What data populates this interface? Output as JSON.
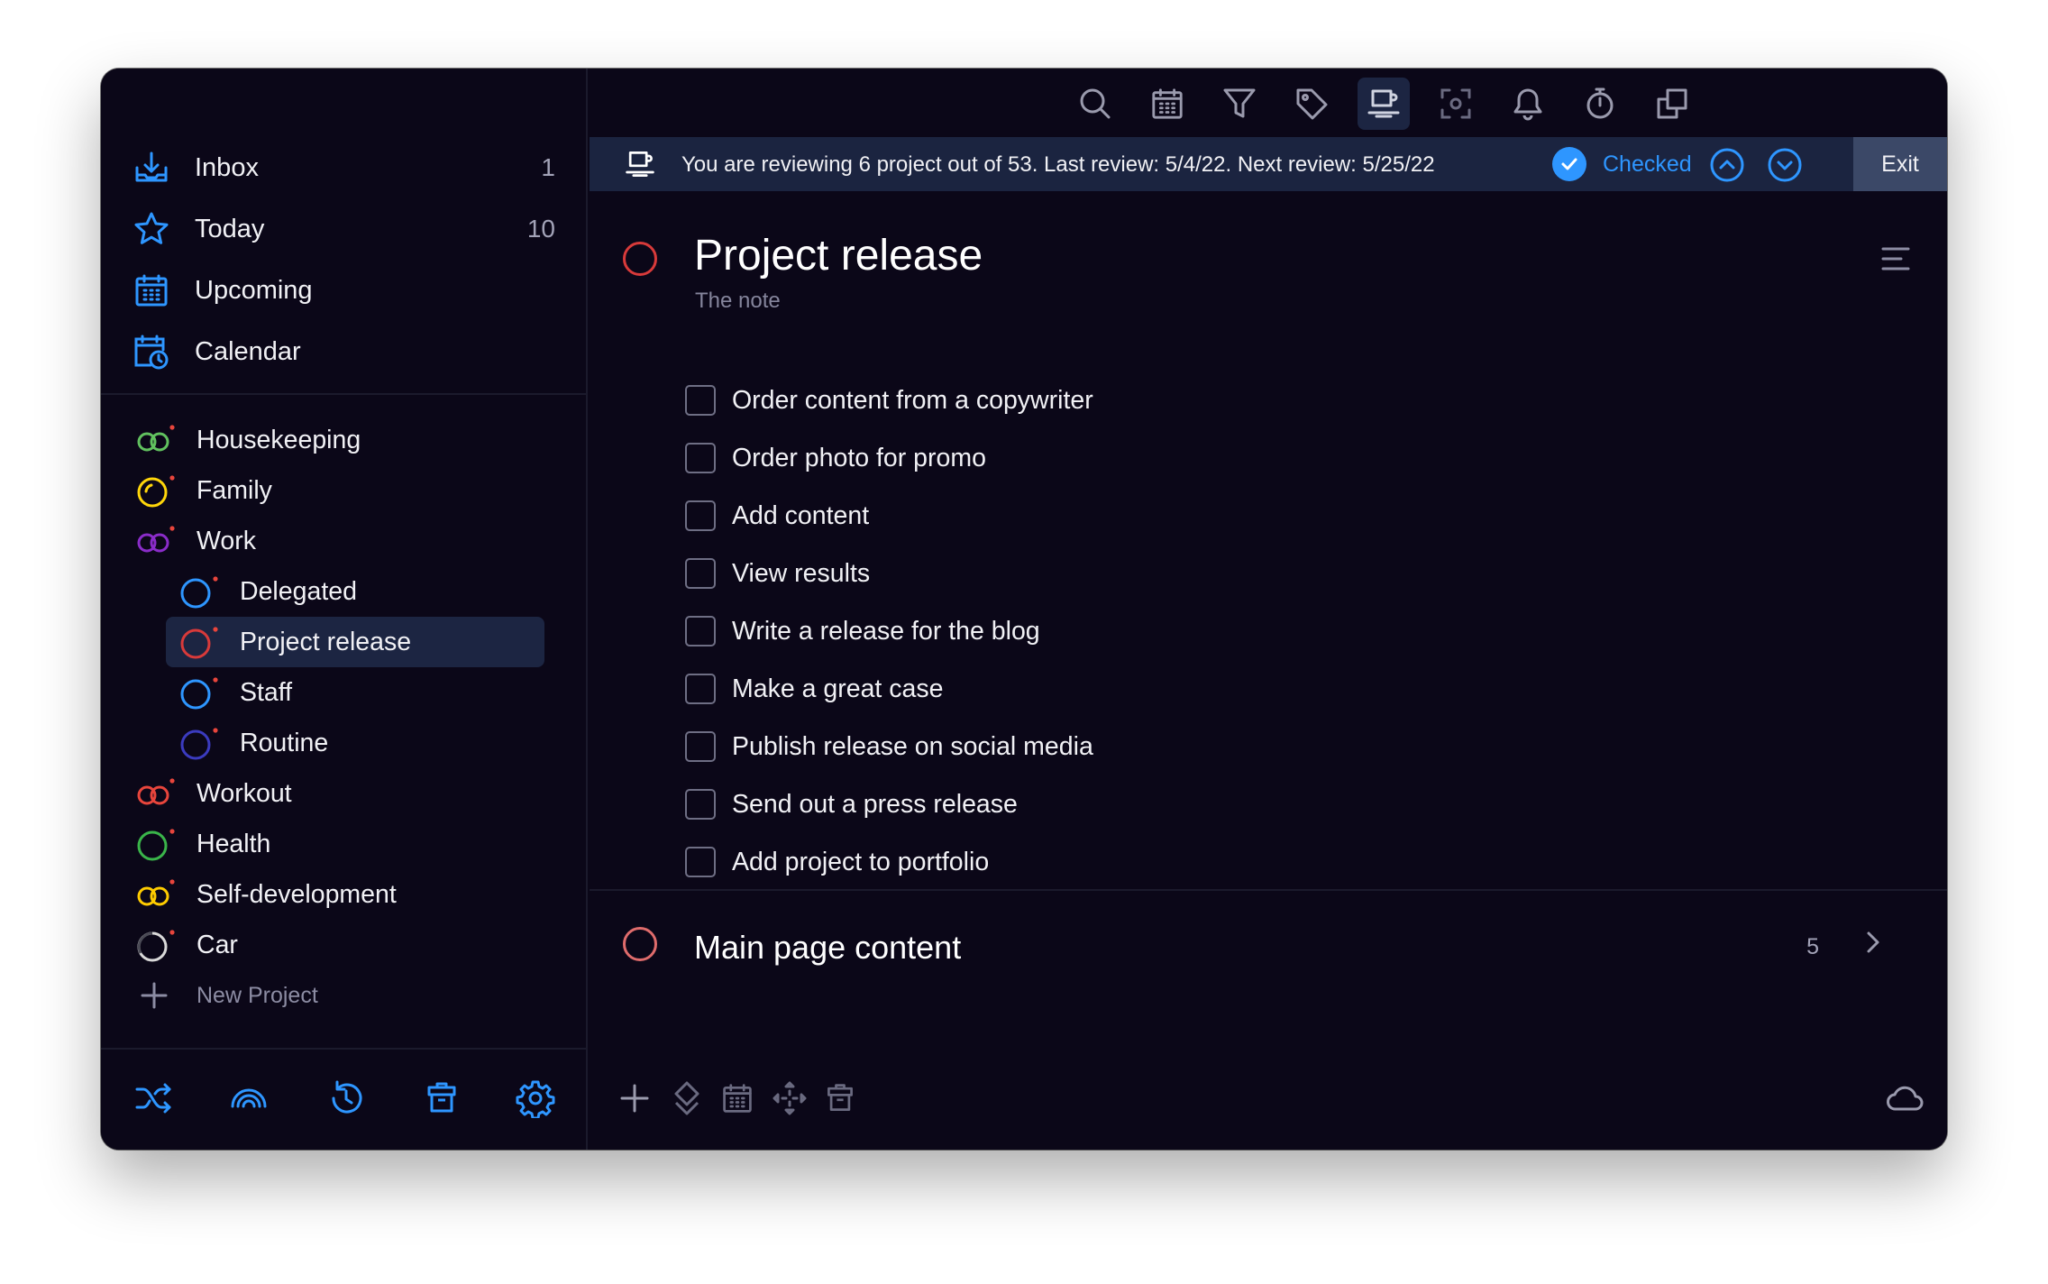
{
  "sidebar": {
    "nav": [
      {
        "label": "Inbox",
        "count": "1",
        "icon": "inbox-tray-icon"
      },
      {
        "label": "Today",
        "count": "10",
        "icon": "star-icon"
      },
      {
        "label": "Upcoming",
        "count": "",
        "icon": "calendar-grid-icon"
      },
      {
        "label": "Calendar",
        "count": "",
        "icon": "calendar-clock-icon"
      }
    ],
    "projects": [
      {
        "label": "Housekeeping",
        "color": "#61c15f",
        "style": "infinity"
      },
      {
        "label": "Family",
        "color": "#ffd60a",
        "style": "ring-bright"
      },
      {
        "label": "Work",
        "color": "#8a2cc9",
        "style": "infinity"
      },
      {
        "label": "Delegated",
        "color": "#2e96ff",
        "style": "ring"
      },
      {
        "label": "Project release",
        "color": "#d83a3a",
        "style": "ring"
      },
      {
        "label": "Staff",
        "color": "#2e96ff",
        "style": "ring"
      },
      {
        "label": "Routine",
        "color": "#3b3bbf",
        "style": "ring"
      },
      {
        "label": "Workout",
        "color": "#e8453c",
        "style": "infinity"
      },
      {
        "label": "Health",
        "color": "#3ab54a",
        "style": "ring"
      },
      {
        "label": "Self-development",
        "color": "#ffcc00",
        "style": "infinity"
      },
      {
        "label": "Car",
        "color": "#d9d9d9",
        "style": "ring"
      }
    ],
    "new_project_label": "New Project",
    "bottom_icons": [
      "shuffle-icon",
      "rainbow-icon",
      "history-icon",
      "trash-icon",
      "settings-gear-icon"
    ]
  },
  "toolbar": {
    "icons": [
      "search-icon",
      "calendar-icon",
      "filter-icon",
      "tag-icon",
      "review-cup-icon",
      "focus-icon",
      "bell-icon",
      "timer-icon",
      "windows-icon"
    ]
  },
  "review": {
    "text": "You are reviewing 6 project out of 53. Last review: 5/4/22. Next review: 5/25/22",
    "checked_label": "Checked",
    "exit_label": "Exit"
  },
  "project": {
    "title": "Project release",
    "note": "The note",
    "tasks": [
      "Order content from a copywriter",
      "Order photo for promo",
      "Add content",
      "View results",
      "Write a release for the blog",
      "Make a great case",
      "Publish release on social media",
      "Send out a press release",
      "Add project to portfolio"
    ]
  },
  "subproject": {
    "title": "Main page content",
    "count": "5"
  },
  "colors": {
    "accent": "#2e96ff",
    "project_release": "#d83a3a",
    "subproject": "#e06c6c",
    "background": "#0b0718",
    "review_bar": "#1b2440",
    "exit_button": "#3b4867"
  }
}
